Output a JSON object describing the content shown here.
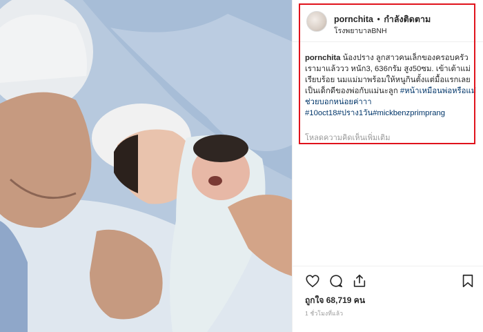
{
  "post": {
    "username": "pornchita",
    "separator": "•",
    "follow_status": "กำลังติดตาม",
    "location": "โรงพยาบาลBNH"
  },
  "caption": {
    "username": "pornchita",
    "text": "น้องปราง ลูกสาวคนเล็กของครอบครัวเรามาแล้ววว หนัก3, 636กรัม สูง50ซม. เข้าเต้าแม่เรียบร้อย นมแม่มาพร้อมให้หนูกินตั้งแต่มื้อแรกเลย เป็นเด็กดีของพ่อกับแม่นะลูก",
    "hashtags": "#หน้าเหมือนพ่อหรือแม่ช่วยบอกหน่อยค่าาา #10oct18#ปราง1วัน#mickbenzprimprang",
    "load_more": "โหลดความคิดเห็นเพิ่มเติม"
  },
  "actions": {
    "like_icon": "heart-icon",
    "comment_icon": "comment-icon",
    "share_icon": "share-icon",
    "save_icon": "bookmark-icon"
  },
  "stats": {
    "likes": "ถูกใจ 68,719 คน",
    "time": "1 ชั่วโมงที่แล้ว"
  },
  "colors": {
    "highlight_border": "#e0121b",
    "hashtag": "#003569",
    "muted": "#999999"
  }
}
